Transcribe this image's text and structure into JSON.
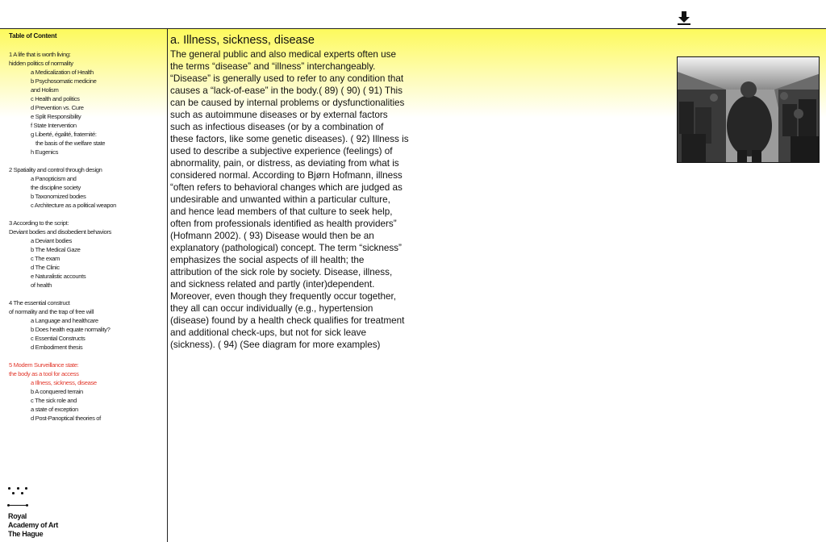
{
  "header": {
    "download_icon": "download-icon"
  },
  "sidebar": {
    "toc_title": "Table of Content",
    "toc_lines": [
      {
        "text": "1  A life that is worth living:",
        "indent": 0
      },
      {
        "text": "hidden politics of normality",
        "indent": 0
      },
      {
        "text": "a Medicalization of Health",
        "indent": 1
      },
      {
        "text": "b Psychosomatic medicine",
        "indent": 1
      },
      {
        "text": "and Holism",
        "indent": 1
      },
      {
        "text": "c  Health and politics",
        "indent": 1
      },
      {
        "text": "d Prevention vs. Cure",
        "indent": 1
      },
      {
        "text": "e Split Responsibility",
        "indent": 1
      },
      {
        "text": "f   State Intervention",
        "indent": 1
      },
      {
        "text": "g Liberté, égalité, fraternité:",
        "indent": 1
      },
      {
        "text": "the basis of the welfare state",
        "indent": 2
      },
      {
        "text": "h Eugenics",
        "indent": 1
      },
      {
        "gap": true
      },
      {
        "text": "2  Spatiality and control through design",
        "indent": 0
      },
      {
        "text": "a Panopticism and",
        "indent": 1
      },
      {
        "text": "the discipline society",
        "indent": 1
      },
      {
        "text": "b Taxonomized bodies",
        "indent": 1
      },
      {
        "text": "c  Architecture as a political weapon",
        "indent": 1
      },
      {
        "gap": true
      },
      {
        "text": "3  According to the script:",
        "indent": 0
      },
      {
        "text": "Deviant bodies and disobedient behaviors",
        "indent": 0
      },
      {
        "text": "a Deviant bodies",
        "indent": 1
      },
      {
        "text": "b The Medical Gaze",
        "indent": 1
      },
      {
        "text": "c  The exam",
        "indent": 1
      },
      {
        "text": "d The Clinic",
        "indent": 1
      },
      {
        "text": "e Naturalistic accounts",
        "indent": 1
      },
      {
        "text": "of health",
        "indent": 1
      },
      {
        "gap": true
      },
      {
        "text": "4  The essential construct",
        "indent": 0
      },
      {
        "text": "of normality and the trap of free will",
        "indent": 0
      },
      {
        "text": "a Language and healthcare",
        "indent": 1
      },
      {
        "text": "b Does health equate normality?",
        "indent": 1
      },
      {
        "text": "c  Essential Constructs",
        "indent": 1
      },
      {
        "text": "d Embodiment thesis",
        "indent": 1
      },
      {
        "gap": true
      },
      {
        "text": "5  Modern Surveillance state:",
        "indent": 0,
        "active": true
      },
      {
        "text": " the body as a tool for access",
        "indent": 0,
        "active": true
      },
      {
        "text": "a Illness, sickness, disease",
        "indent": 1,
        "active": true
      },
      {
        "text": "b A conquered terrain",
        "indent": 1
      },
      {
        "text": "c  The sick role and",
        "indent": 1
      },
      {
        "text": " a state of exception",
        "indent": 1
      },
      {
        "text": "d Post-Panoptical theories of",
        "indent": 1
      }
    ],
    "logo": {
      "lines": [
        "Royal",
        "Academy of Art",
        "The Hague"
      ]
    }
  },
  "article": {
    "heading": "a. Illness, sickness, disease",
    "lines": [
      "The general public and also medical experts often use",
      "the terms “disease” and “illness” interchangeably.",
      "“Disease” is generally used to refer to any condition that",
      "causes a “lack-of-ease” in the body.( 89)  ( 90) ( 91) This",
      "can be caused by internal problems or dysfunctionalities",
      "such as autoimmune diseases or by external factors",
      "such as infectious diseases (or by a combination of",
      "these factors, like some genetic diseases). ( 92) Illness is",
      "used to describe a subjective experience (feelings) of",
      "abnormality, pain, or distress, as deviating from what is",
      "considered normal. According to Bjørn Hofmann, illness",
      "“often refers to behavioral changes which are judged as",
      "undesirable and unwanted within a particular culture,",
      "and hence lead members of that culture to seek help,",
      "often from professionals identified as health providers”",
      "(Hofmann 2002). ( 93) Disease would then be an",
      "explanatory (pathological) concept. The term “sickness”",
      "emphasizes the social aspects of ill health; the",
      "attribution of the sick role by society. Disease, illness,",
      "and sickness related and partly (inter)dependent.",
      "Moreover, even though they frequently occur together,",
      "they all can occur individually (e.g., hypertension",
      "(disease) found by a health check qualifies for treatment",
      "and additional check-ups, but not for sick leave",
      "(sickness). ( 94) (See diagram for more examples)"
    ]
  },
  "image": {
    "icon": "airplane-cabin-photo"
  },
  "colors": {
    "highlight": "#fdfa5c",
    "active_link": "#e23a2e"
  }
}
